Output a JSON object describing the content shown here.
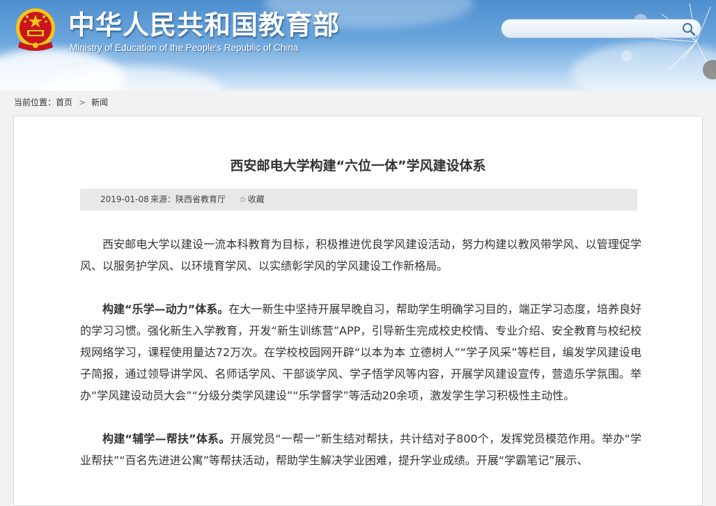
{
  "header": {
    "title_cn": "中华人民共和国教育部",
    "title_en": "Ministry of Education of the People's Republic of China",
    "emblem_icon": "national-emblem-icon",
    "colors": {
      "sky_top": "#4f8fd0",
      "sky_bottom": "#dcecf8",
      "emblem_red": "#c8161d",
      "emblem_gold": "#f5c518"
    }
  },
  "search": {
    "placeholder": "",
    "value": "",
    "icon": "search-icon"
  },
  "breadcrumb": {
    "prefix": "当前位置：",
    "items": [
      "首页",
      "新闻"
    ],
    "separator": ">"
  },
  "article": {
    "title": "西安邮电大学构建“六位一体”学风建设体系",
    "date": "2019-01-08",
    "source": "来源：陕西省教育厅",
    "favorite_label": "收藏",
    "favorite_icon": "star-icon",
    "paragraphs": [
      {
        "lead": "",
        "text": "西安邮电大学以建设一流本科教育为目标，积极推进优良学风建设活动，努力构建以教风带学风、以管理促学风、以服务护学风、以环境育学风、以实绩彰学风的学风建设工作新格局。"
      },
      {
        "lead": "构建“乐学—动力”体系。",
        "text": "在大一新生中坚持开展早晚自习，帮助学生明确学习目的，端正学习态度，培养良好的学习习惯。强化新生入学教育，开发“新生训练营”APP，引导新生完成校史校情、专业介绍、安全教育与校纪校规网络学习，课程使用量达72万次。在学校校园网开辟“以本为本 立德树人”“学子风采”等栏目，编发学风建设电子简报，通过领导讲学风、名师话学风、干部谈学风、学子悟学风等内容，开展学风建设宣传，营造乐学氛围。举办“学风建设动员大会”“分级分类学风建设”“乐学督学”等活动20余项，激发学生学习积极性主动性。"
      },
      {
        "lead": "构建“辅学—帮扶”体系。",
        "text": "开展党员“一帮一”新生结对帮扶，共计结对子800个，发挥党员模范作用。举办“学业帮扶”“百名先进进公寓”等帮扶活动，帮助学生解决学业困难，提升学业成绩。开展“学霸笔记”展示、"
      }
    ]
  }
}
